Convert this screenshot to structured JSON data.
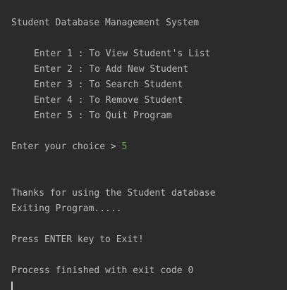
{
  "console": {
    "title": "Student Database Management System",
    "menu_items": [
      "Enter 1 : To View Student's List",
      "Enter 2 : To Add New Student",
      "Enter 3 : To Search Student",
      "Enter 4 : To Remove Student",
      "Enter 5 : To Quit Program"
    ],
    "prompt": "Enter your choice > ",
    "user_input": "5",
    "thanks_message": "Thanks for using the Student database",
    "exiting_message": "Exiting Program.....",
    "press_enter_message": "Press ENTER key to Exit!",
    "process_finished": "Process finished with exit code 0"
  },
  "colors": {
    "background": "#2b2b2b",
    "text": "#bbbbbb",
    "user_input": "#5fa844"
  }
}
